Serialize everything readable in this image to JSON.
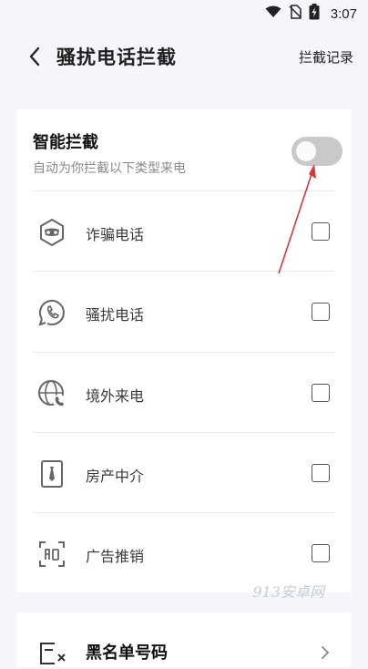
{
  "status_bar": {
    "time": "3:07"
  },
  "header": {
    "back_icon": "chevron-left-icon",
    "title": "骚扰电话拦截",
    "record_link": "拦截记录"
  },
  "smart_block": {
    "title": "智能拦截",
    "subtitle": "自动为你拦截以下类型来电",
    "toggle_on": false
  },
  "categories": [
    {
      "label": "诈骗电话",
      "icon": "fraud-mask-icon",
      "checked": false
    },
    {
      "label": "骚扰电话",
      "icon": "phone-circle-icon",
      "checked": false
    },
    {
      "label": "境外来电",
      "icon": "globe-phone-icon",
      "checked": false
    },
    {
      "label": "房产中介",
      "icon": "tie-card-icon",
      "checked": false
    },
    {
      "label": "广告推销",
      "icon": "ad-frame-icon",
      "checked": false
    }
  ],
  "blacklist": {
    "label": "黑名单号码",
    "icon": "blocked-list-icon"
  },
  "watermark": "913安卓网",
  "colors": {
    "background": "#f4f6fb",
    "card": "#ffffff",
    "annotation_arrow": "#d9363e",
    "toggle_off": "#c9c9c9"
  }
}
